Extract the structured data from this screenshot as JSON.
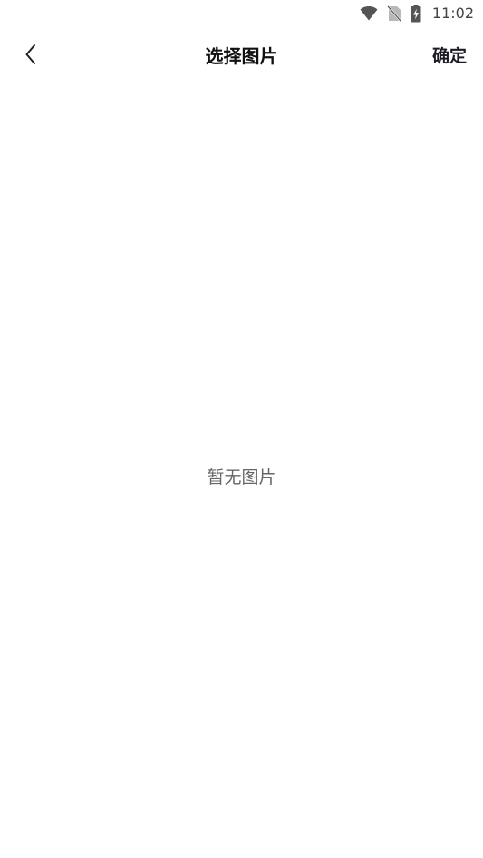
{
  "status_bar": {
    "time": "11:02",
    "icons": [
      "wifi-icon",
      "no-sim-icon",
      "battery-charging-icon"
    ]
  },
  "header": {
    "back_icon": "chevron-left-icon",
    "title": "选择图片",
    "confirm_label": "确定"
  },
  "main": {
    "empty_message": "暂无图片"
  },
  "colors": {
    "background": "#ffffff",
    "title": "#111111",
    "confirm": "#1c1c24",
    "empty_text": "#666666",
    "status_icons": "#555555"
  }
}
